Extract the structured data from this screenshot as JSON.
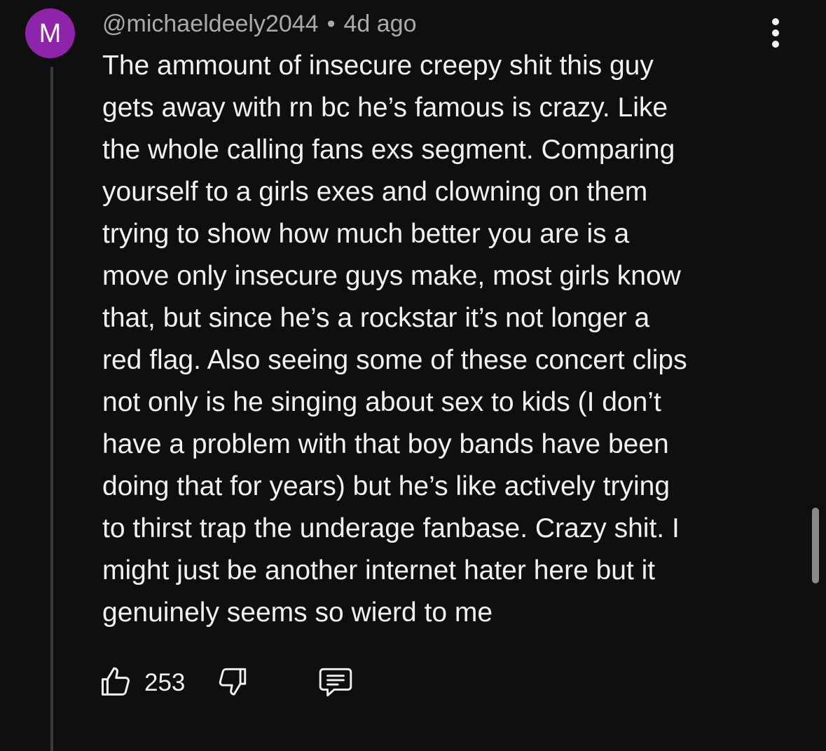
{
  "comment": {
    "avatar_letter": "M",
    "avatar_color": "#8e24aa",
    "author": "@michaeldeely2044",
    "separator": "•",
    "timestamp": "4d ago",
    "menu_icon": "more-vert-icon",
    "text_lines": [
      "The ammount of insecure creepy shit this guy",
      "gets away with rn bc he’s famous is crazy. Like",
      "the whole calling fans exs segment. Comparing",
      "yourself to a girls exes and clowning on them",
      "trying to show how much better you are is a",
      "move only insecure guys make, most girls know",
      "that, but since he’s a rockstar it’s not longer a",
      "red flag. Also seeing some of these concert clips",
      "not only is he singing about sex to kids (I don’t",
      "have a problem with that boy bands have been",
      "doing that for years) but he’s like actively trying",
      "to thirst trap the underage fanbase. Crazy shit. I",
      "might just be another internet hater here but it",
      "genuinely seems so wierd to me"
    ],
    "actions": {
      "like_icon": "thumbs-up-icon",
      "like_count": "253",
      "dislike_icon": "thumbs-down-icon",
      "reply_icon": "comment-reply-icon"
    }
  },
  "colors": {
    "background": "#0f0f0f",
    "text": "#f1f1f1",
    "meta_text": "#aaaaaa"
  }
}
